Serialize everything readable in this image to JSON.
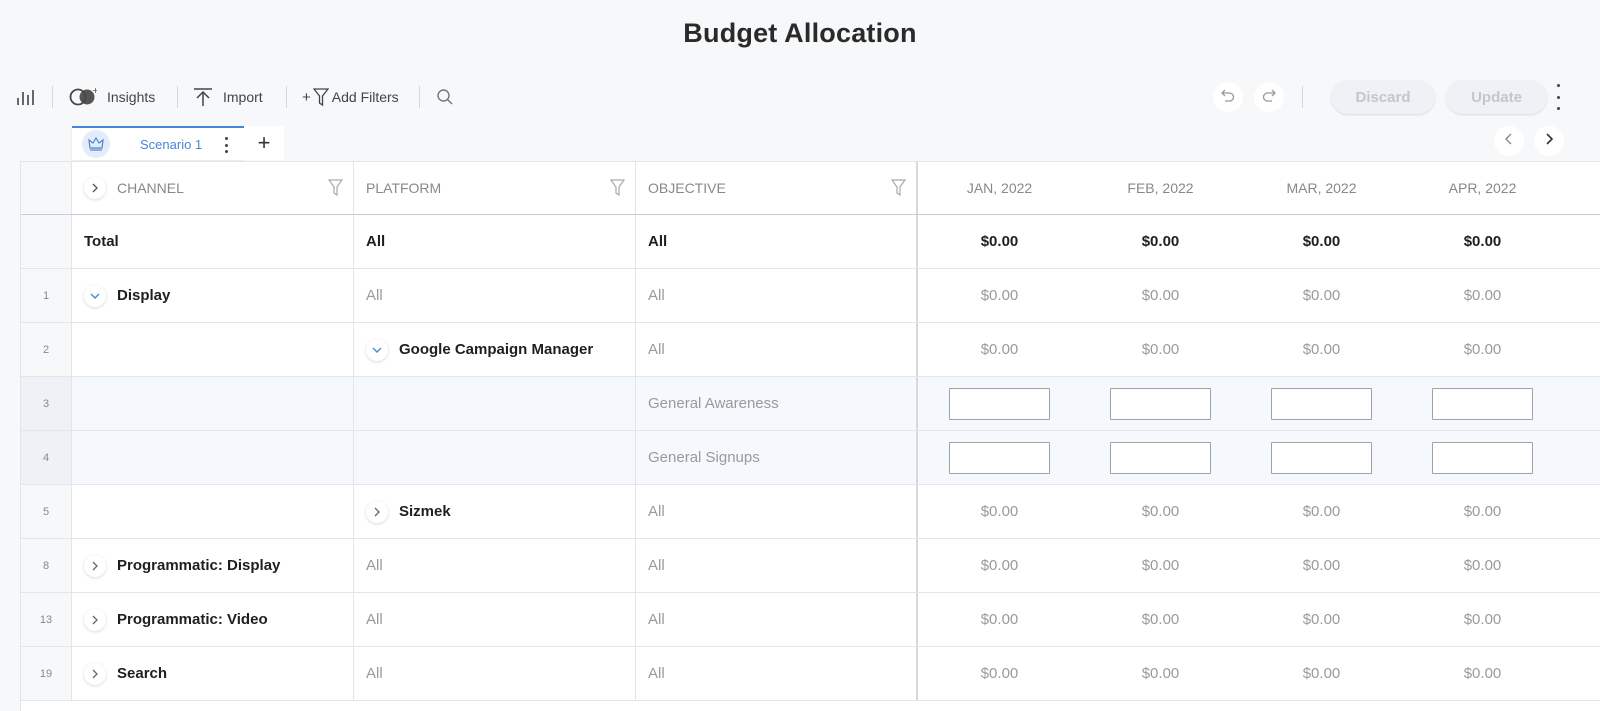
{
  "page": {
    "title": "Budget Allocation"
  },
  "toolbar": {
    "insights_label": "Insights",
    "import_label": "Import",
    "add_filters_label": "Add Filters",
    "add_filters_prefix": "+",
    "discard_label": "Discard",
    "update_label": "Update"
  },
  "tabs": [
    {
      "label": "Scenario 1",
      "active": true
    }
  ],
  "tab_add_label": "+",
  "columns": {
    "channel": "CHANNEL",
    "platform": "PLATFORM",
    "objective": "OBJECTIVE",
    "months": [
      "JAN, 2022",
      "FEB, 2022",
      "MAR, 2022",
      "APR, 2022"
    ]
  },
  "rows": [
    {
      "idx": "",
      "channel": "Total",
      "platform": "All",
      "objective": "All",
      "values": [
        "$0.00",
        "$0.00",
        "$0.00",
        "$0.00"
      ],
      "kind": "total"
    },
    {
      "idx": "1",
      "channel": "Display",
      "platform": "All",
      "objective": "All",
      "values": [
        "$0.00",
        "$0.00",
        "$0.00",
        "$0.00"
      ],
      "kind": "channel",
      "expanded": true
    },
    {
      "idx": "2",
      "channel": "",
      "platform": "Google Campaign Manager",
      "objective": "All",
      "values": [
        "$0.00",
        "$0.00",
        "$0.00",
        "$0.00"
      ],
      "kind": "platform",
      "expanded": true
    },
    {
      "idx": "3",
      "channel": "",
      "platform": "",
      "objective": "General Awareness",
      "values": [
        "",
        "",
        "",
        ""
      ],
      "kind": "input"
    },
    {
      "idx": "4",
      "channel": "",
      "platform": "",
      "objective": "General Signups",
      "values": [
        "",
        "",
        "",
        ""
      ],
      "kind": "input"
    },
    {
      "idx": "5",
      "channel": "",
      "platform": "Sizmek",
      "objective": "All",
      "values": [
        "$0.00",
        "$0.00",
        "$0.00",
        "$0.00"
      ],
      "kind": "platform",
      "expanded": false
    },
    {
      "idx": "8",
      "channel": "Programmatic: Display",
      "platform": "All",
      "objective": "All",
      "values": [
        "$0.00",
        "$0.00",
        "$0.00",
        "$0.00"
      ],
      "kind": "channel",
      "expanded": false
    },
    {
      "idx": "13",
      "channel": "Programmatic: Video",
      "platform": "All",
      "objective": "All",
      "values": [
        "$0.00",
        "$0.00",
        "$0.00",
        "$0.00"
      ],
      "kind": "channel",
      "expanded": false
    },
    {
      "idx": "19",
      "channel": "Search",
      "platform": "All",
      "objective": "All",
      "values": [
        "$0.00",
        "$0.00",
        "$0.00",
        "$0.00"
      ],
      "kind": "channel",
      "expanded": false
    }
  ],
  "colors": {
    "accent": "#4a86d8",
    "muted_text": "#9a9a9a",
    "disabled_button_text": "#c3c7cd"
  },
  "icons": [
    "bar-chart-icon",
    "insights-icon",
    "import-icon",
    "filter-icon",
    "search-icon",
    "undo-icon",
    "redo-icon",
    "more-vertical-icon",
    "crown-icon",
    "chevron-left-icon",
    "chevron-right-icon",
    "chevron-down-icon"
  ]
}
